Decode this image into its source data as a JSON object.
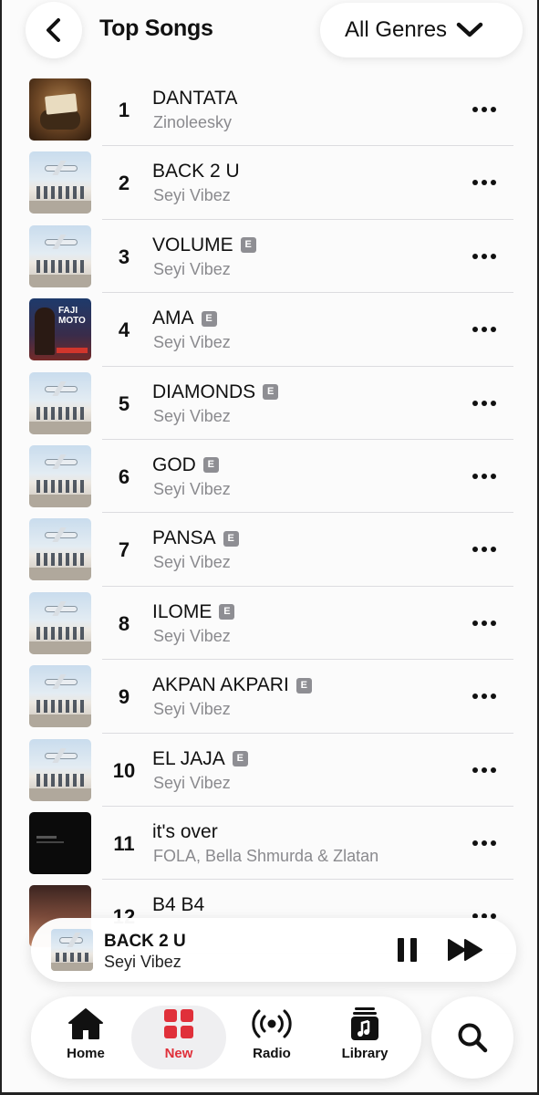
{
  "header": {
    "title": "Top Songs",
    "genre_label": "All Genres",
    "back_icon": "chevron-left-icon",
    "genre_icon": "chevron-down-icon"
  },
  "explicit_badge": "E",
  "songs": [
    {
      "rank": "1",
      "title": "DANTATA",
      "artist": "Zinoleesky",
      "explicit": false,
      "art": "dantata"
    },
    {
      "rank": "2",
      "title": "BACK 2 U",
      "artist": "Seyi Vibez",
      "explicit": false,
      "art": "sky"
    },
    {
      "rank": "3",
      "title": "VOLUME",
      "artist": "Seyi Vibez",
      "explicit": true,
      "art": "sky"
    },
    {
      "rank": "4",
      "title": "AMA",
      "artist": "Seyi Vibez",
      "explicit": true,
      "art": "ama"
    },
    {
      "rank": "5",
      "title": "DIAMONDS",
      "artist": "Seyi Vibez",
      "explicit": true,
      "art": "sky"
    },
    {
      "rank": "6",
      "title": "GOD",
      "artist": "Seyi Vibez",
      "explicit": true,
      "art": "sky"
    },
    {
      "rank": "7",
      "title": "PANSA",
      "artist": "Seyi Vibez",
      "explicit": true,
      "art": "sky"
    },
    {
      "rank": "8",
      "title": "ILOME",
      "artist": "Seyi Vibez",
      "explicit": true,
      "art": "sky"
    },
    {
      "rank": "9",
      "title": "AKPAN AKPARI",
      "artist": "Seyi Vibez",
      "explicit": true,
      "art": "sky"
    },
    {
      "rank": "10",
      "title": "EL JAJA",
      "artist": "Seyi Vibez",
      "explicit": true,
      "art": "sky"
    },
    {
      "rank": "11",
      "title": "it's over",
      "artist": "FOLA, Bella Shmurda & Zlatan",
      "explicit": false,
      "art": "dark"
    },
    {
      "rank": "12",
      "title": "B4 B4",
      "artist": "",
      "explicit": false,
      "art": "b4"
    }
  ],
  "ama_art_text": "FAJI\nMOTO",
  "now_playing": {
    "title": "BACK 2 U",
    "artist": "Seyi Vibez"
  },
  "tabs": [
    {
      "label": "Home",
      "icon": "house-icon",
      "active": false
    },
    {
      "label": "New",
      "icon": "grid-icon",
      "active": true
    },
    {
      "label": "Radio",
      "icon": "broadcast-icon",
      "active": false
    },
    {
      "label": "Library",
      "icon": "music-note-library-icon",
      "active": false
    }
  ],
  "colors": {
    "accent": "#e0303a",
    "secondary_text": "#8a8a8e",
    "explicit_badge": "#8e8e93"
  }
}
